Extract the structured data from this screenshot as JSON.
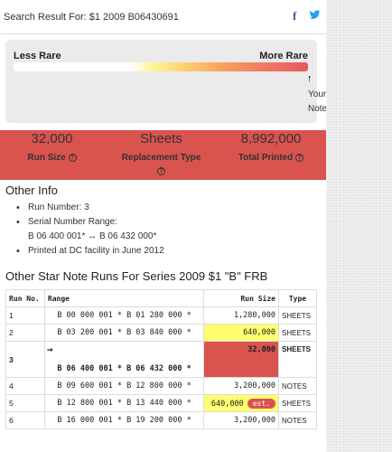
{
  "header": {
    "search_result": "Search Result For: $1 2009 B06430691",
    "facebook_icon": "facebook-icon",
    "twitter_icon": "twitter-icon",
    "facebook_color": "#3b5998",
    "twitter_color": "#1da1f2"
  },
  "rarity": {
    "less_label": "Less Rare",
    "more_label": "More Rare",
    "arrow": "↑",
    "your_note_line1": "Your",
    "your_note_line2": "Note"
  },
  "stats": {
    "run_size_value": "32,000",
    "run_size_label": "Run Size",
    "replacement_value": "Sheets",
    "replacement_label": "Replacement Type",
    "total_value": "8,992,000",
    "total_label": "Total Printed",
    "help_glyph": "?",
    "band_color": "#d9534f"
  },
  "other_info": {
    "title": "Other Info",
    "run_number": "Run Number: 3",
    "serial_range_label": "Serial Number Range:",
    "serial_range_value": "B 06 400 001* ↔ B 06 432 000*",
    "printed_at": "Printed at DC facility in June 2012"
  },
  "runs": {
    "title": "Other Star Note Runs For Series 2009 $1 \"B\" FRB",
    "columns": [
      "Run No.",
      "Range",
      "Run Size",
      "Type"
    ],
    "current_arrow": "→",
    "rows": [
      {
        "run": "1",
        "range": "B 00 000 001 *  B 01 280 000 *",
        "size": "1,280,000",
        "type": "SHEETS"
      },
      {
        "run": "2",
        "range": "B 03 200 001 *  B 03 840 000 *",
        "size": "640,000",
        "type": "SHEETS"
      },
      {
        "run": "3",
        "range": "B 06 400 001 *  B 06 432 000 *",
        "size": "32,000",
        "type": "SHEETS"
      },
      {
        "run": "4",
        "range": "B 09 600 001 *  B 12 800 000 *",
        "size": "3,200,000",
        "type": "NOTES"
      },
      {
        "run": "5",
        "range": "B 12 800 001 *  B 13 440 000 *",
        "size": "640,000",
        "type": "SHEETS",
        "badge": "est."
      },
      {
        "run": "6",
        "range": "B 16 000 001 *  B 19 200 000 *",
        "size": "3,200,000",
        "type": "NOTES"
      }
    ],
    "highlight_yellow": "#ffff70",
    "highlight_red": "#d9534f"
  }
}
